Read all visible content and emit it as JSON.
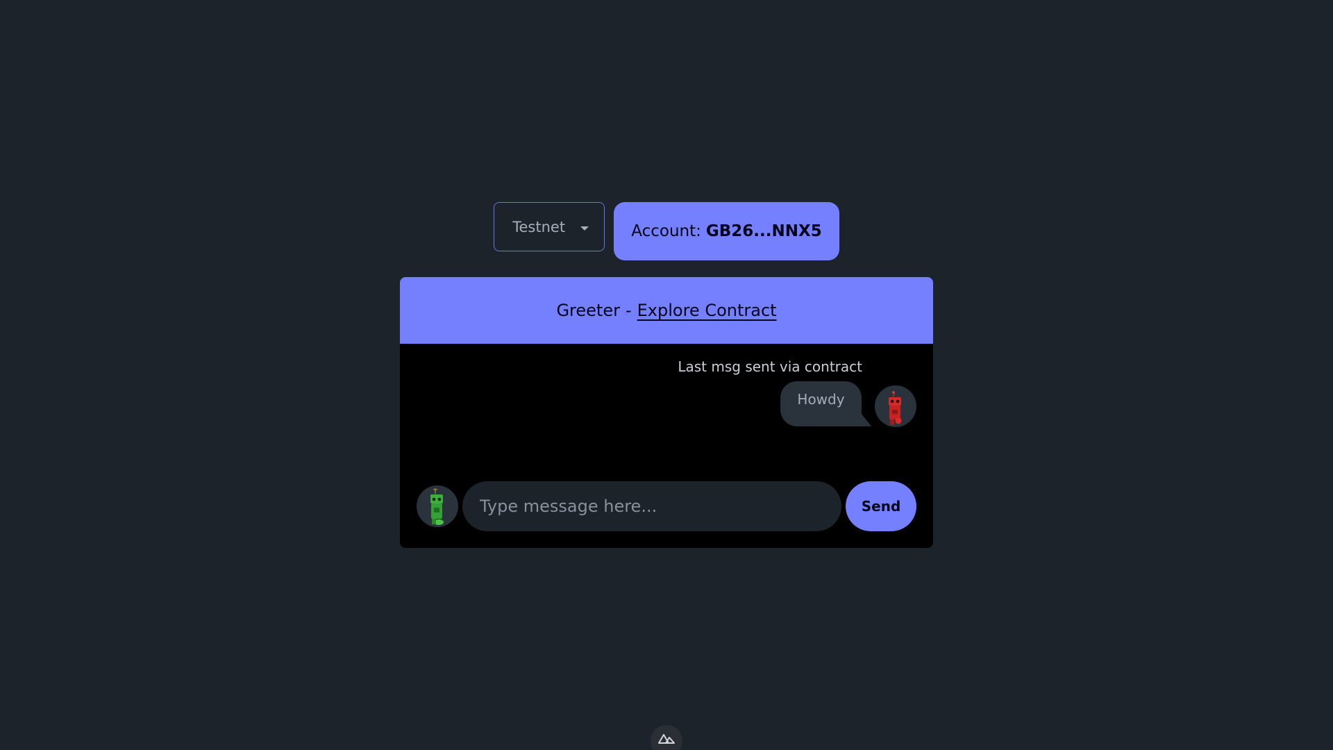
{
  "network": {
    "selected": "Testnet"
  },
  "account": {
    "label": "Account:",
    "address": "GB26...NNX5"
  },
  "card": {
    "title": "Greeter",
    "separator": "-",
    "link_label": "Explore Contract"
  },
  "chat": {
    "header": "Last msg sent via contract",
    "last_message": "Howdy",
    "input_placeholder": "Type message here...",
    "send_label": "Send"
  },
  "icons": {
    "network_dropdown": "chevron-down-icon",
    "receiver_avatar": "red-robot-avatar",
    "user_avatar": "green-robot-avatar",
    "devtools": "nuxt-logo-icon"
  },
  "colors": {
    "background": "#1d232a",
    "primary": "#7480ff",
    "card_body": "#000000",
    "bubble": "#2a323c"
  }
}
